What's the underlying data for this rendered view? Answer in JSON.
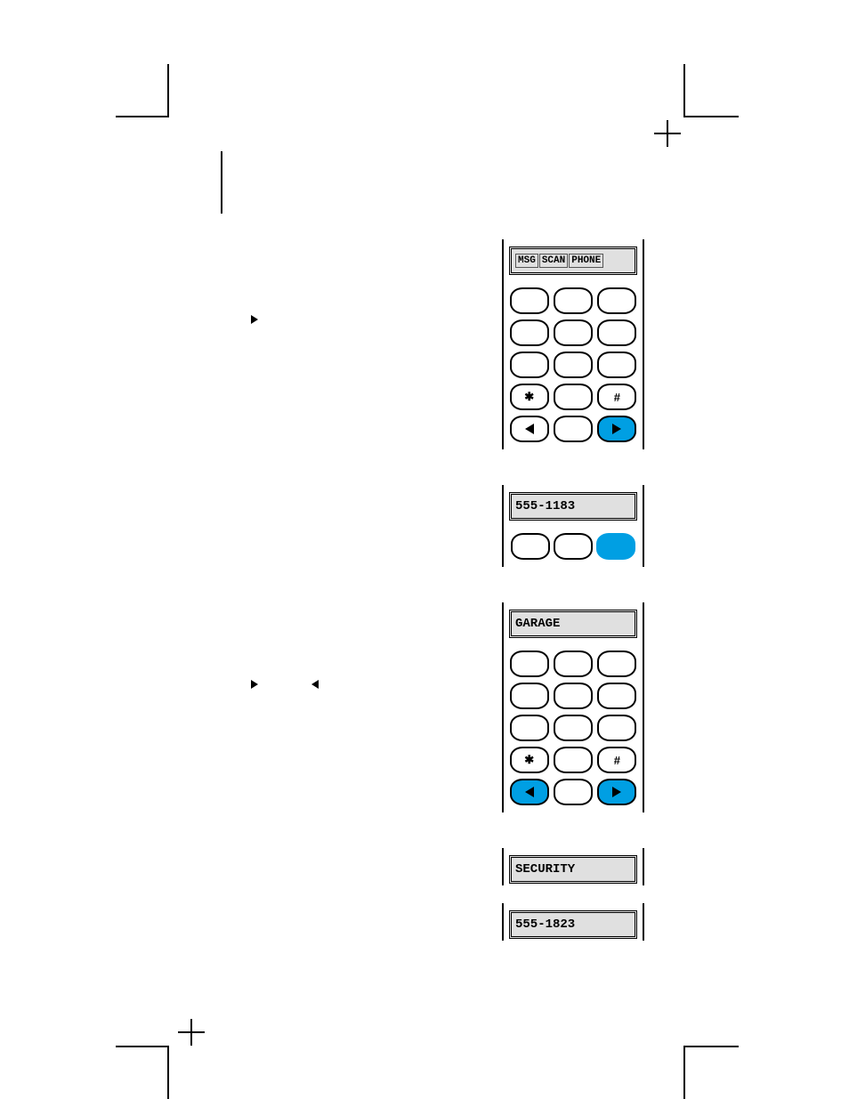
{
  "marks": {},
  "panels": {
    "menu": {
      "lcd_items": [
        "MSG",
        "SCAN",
        "PHONE"
      ],
      "keys": {
        "star": "✱",
        "hash": "#"
      }
    },
    "number1": {
      "lcd": "555-1183"
    },
    "garage": {
      "lcd": "GARAGE",
      "keys": {
        "star": "✱",
        "hash": "#"
      }
    },
    "security": {
      "lcd": "SECURITY"
    },
    "number2": {
      "lcd": "555-1823"
    }
  }
}
